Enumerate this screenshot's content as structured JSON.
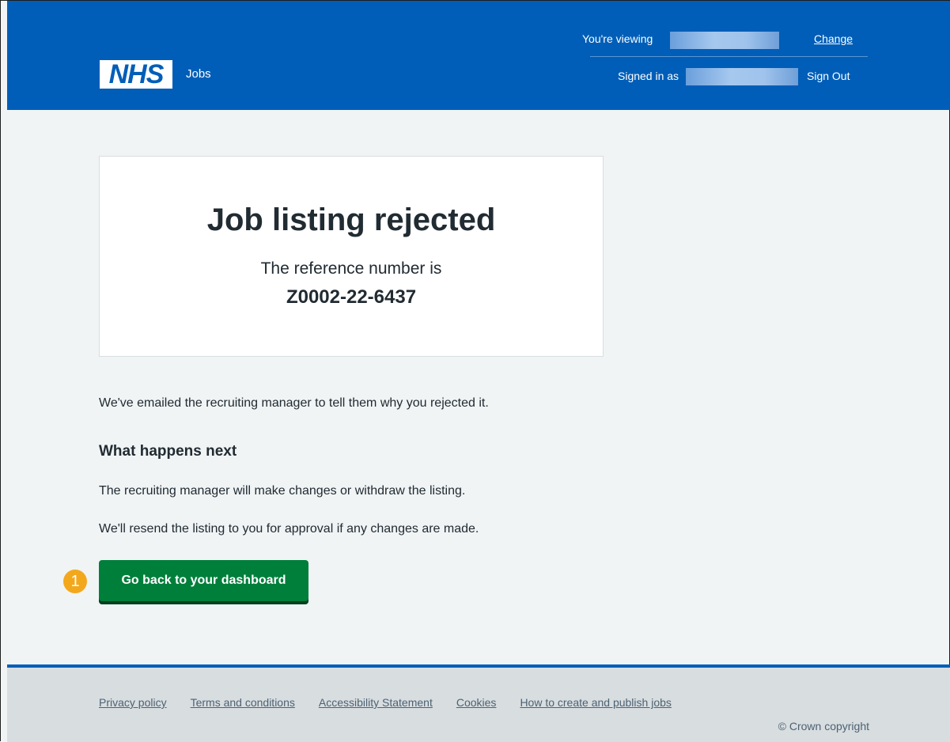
{
  "header": {
    "logo_text": "NHS",
    "service_name": "Jobs",
    "viewing_label": "You're viewing",
    "change_link": "Change",
    "signed_in_label": "Signed in as",
    "sign_out_link": "Sign Out"
  },
  "panel": {
    "title": "Job listing rejected",
    "reference_label": "The reference number is",
    "reference_number": "Z0002-22-6437"
  },
  "content": {
    "emailed_text": "We've emailed the recruiting manager to tell them why you rejected it.",
    "next_heading": "What happens next",
    "next_text_1": "The recruiting manager will make changes or withdraw the listing.",
    "next_text_2": "We'll resend the listing to you for approval if any changes are made.",
    "dashboard_button": "Go back to your dashboard",
    "step_badge": "1"
  },
  "footer": {
    "links": [
      "Privacy policy",
      "Terms and conditions",
      "Accessibility Statement",
      "Cookies",
      "How to create and publish jobs"
    ],
    "copyright": "© Crown copyright"
  },
  "colors": {
    "header_blue": "#005eb8",
    "button_green": "#007f3b",
    "badge_orange": "#f3a81c",
    "background": "#f0f4f5"
  }
}
